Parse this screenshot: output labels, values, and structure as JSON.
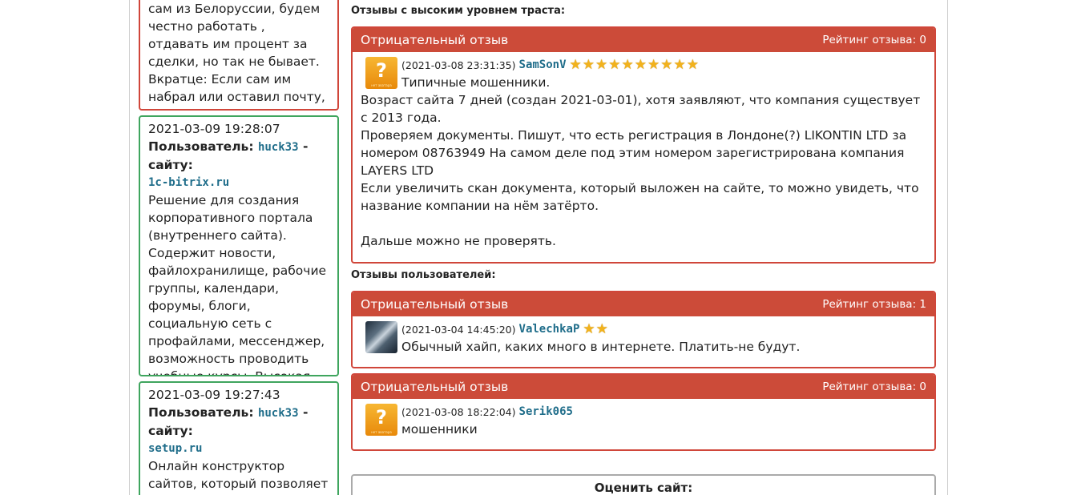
{
  "left_cards": [
    {
      "kind": "red",
      "text": "сам из Белоруссии, будем честно работать , отдавать им процент за сделки, но так не бывает. Вкратце: Если сам им набрал или оставил почту, жди )) На..."
    },
    {
      "kind": "green",
      "date": "2021-03-09 19:28:07",
      "user_prefix": "Пользователь:",
      "user": "huck33",
      "site_suffix": "- сайту:",
      "site": "1c-bitrix.ru",
      "text": "Решение для создания корпоративного портала (внутреннего сайта). Содержит новости, файлохранилище, рабочие группы, календари, форумы, блоги, социальную сеть с профайлами, мессенджер, возможность проводить учебные курсы. Высокая производительность. Ин..."
    },
    {
      "kind": "green",
      "date": "2021-03-09 19:27:43",
      "user_prefix": "Пользователь:",
      "user": "huck33",
      "site_suffix": "- сайту:",
      "site": "setup.ru",
      "text": "Онлайн конструктор сайтов, который позволяет создать сайт без помощи"
    }
  ],
  "trusted_title": "Отзывы с высоким уровнем траста:",
  "users_title": "Отзывы пользователей:",
  "reviews": [
    {
      "type": "Отрицательный отзыв",
      "rating": "Рейтинг отзыва: 0",
      "avatar": "question-avatar",
      "date": "(2021-03-08 23:31:35)",
      "user": "SamSonV",
      "stars": 10,
      "first_line": "Типичные мошенники.",
      "lines": [
        "Возраст сайта 7 дней (создан 2021-03-01), хотя заявляют, что компания существует с 2013 года.",
        "Проверяем документы. Пишут, что есть регистрация в Лондоне(?) LIKONTIN LTD за номером 08763949 На самом деле под этим номером зарегистрирована компания LAYERS LTD",
        "Если увеличить скан документа, который выложен на сайте, то можно увидеть, что название компании на нём затёрто.",
        "",
        "Дальше можно не проверять."
      ]
    },
    {
      "type": "Отрицательный отзыв",
      "rating": "Рейтинг отзыва: 1",
      "avatar": "photo-avatar",
      "date": "(2021-03-04 14:45:20)",
      "user": "ValechkaP",
      "stars": 2,
      "first_line": "Обычный хайп, каких много в интернете. Платить-не будут.",
      "lines": []
    },
    {
      "type": "Отрицательный отзыв",
      "rating": "Рейтинг отзыва: 0",
      "avatar": "question-avatar",
      "date": "(2021-03-08 18:22:04)",
      "user": "Serik065",
      "stars": 0,
      "first_line": "мошенники",
      "lines": []
    }
  ],
  "rate_site_label": "Оценить сайт:",
  "avatar_caption": "нет аватара",
  "colors": {
    "negative": "#cc4b39",
    "positive_border": "#3fa55e",
    "link": "#1f6d8a",
    "star": "#f2b21c"
  }
}
